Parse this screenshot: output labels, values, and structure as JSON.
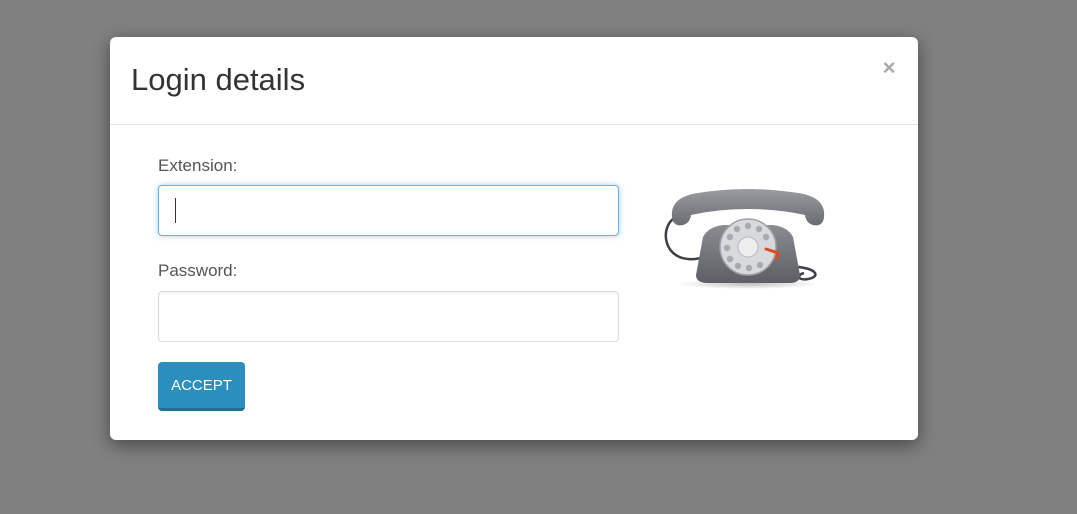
{
  "modal": {
    "title": "Login details",
    "close_label": "×"
  },
  "form": {
    "extension_label": "Extension:",
    "extension_value": "",
    "password_label": "Password:",
    "password_value": "",
    "accept_label": "ACCEPT"
  },
  "icons": {
    "close": "close-icon",
    "phone": "rotary-telephone-icon"
  },
  "colors": {
    "backdrop": "#808080",
    "accent": "#2a8fbd",
    "focus_border": "#66afe9",
    "dial_accent": "#e04a1f"
  }
}
